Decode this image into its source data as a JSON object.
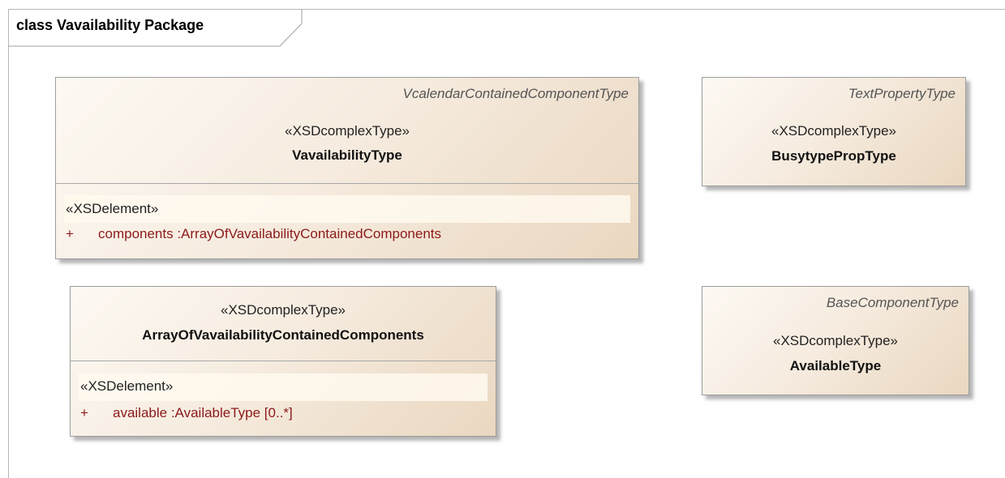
{
  "diagram": {
    "frame_title": "class Vavailability Package"
  },
  "classes": {
    "vavailability_type": {
      "parent": "VcalendarContainedComponentType",
      "stereotype": "«XSDcomplexType»",
      "name": "VavailabilityType",
      "attr_stereotype": "«XSDelement»",
      "attr_visibility": "+",
      "attr_text": "components  :ArrayOfVavailabilityContainedComponents"
    },
    "busytype_prop_type": {
      "parent": "TextPropertyType",
      "stereotype": "«XSDcomplexType»",
      "name": "BusytypePropType"
    },
    "array_of_vavailability": {
      "stereotype": "«XSDcomplexType»",
      "name": "ArrayOfVavailabilityContainedComponents",
      "attr_stereotype": "«XSDelement»",
      "attr_visibility": "+",
      "attr_text": "available  :AvailableType [0..*]"
    },
    "available_type": {
      "parent": "BaseComponentType",
      "stereotype": "«XSDcomplexType»",
      "name": "AvailableType"
    }
  }
}
